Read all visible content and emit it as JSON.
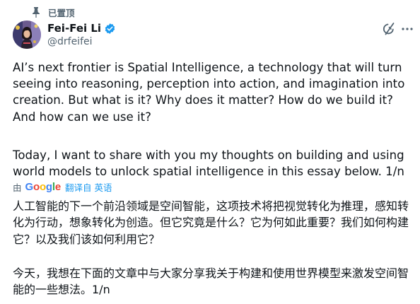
{
  "pinned": {
    "label": "已置顶",
    "icon": "pin-icon"
  },
  "author": {
    "display_name": "Fei-Fei Li",
    "handle": "@drfeifei",
    "verified": true,
    "verified_color": "#1d9bf0"
  },
  "actions": {
    "grok_icon": "grok-icon",
    "more_icon": "more-horizontal-icon"
  },
  "tweet": {
    "paragraph_1": "AI’s next frontier is Spatial Intelligence, a technology that will turn seeing into reasoning, perception into action, and imagination into creation. But what is it? Why does it matter? How do we build it? And how can we use it?",
    "paragraph_2": "Today, I want to share with you my thoughts on building and using world models to unlock spatial intelligence in this essay below. 1/n"
  },
  "translation": {
    "by_label": "由",
    "provider": "Google",
    "link_label": "翻译自 英语",
    "paragraph_1": "人工智能的下一个前沿领域是空间智能，这项技术将把视觉转化为推理，感知转化为行动，想象转化为创造。但它究竟是什么？它为何如此重要？我们如何构建它？以及我们该如何利用它？",
    "paragraph_2": "今天，我想在下面的文章中与大家分享我关于构建和使用世界模型来激发空间智能的一些想法。1/n"
  },
  "colors": {
    "text_primary": "#0f1419",
    "text_secondary": "#536471",
    "link": "#1d9bf0",
    "google_blue": "#4285F4",
    "google_red": "#EA4335",
    "google_yellow": "#FBBC05",
    "google_green": "#34A853"
  }
}
